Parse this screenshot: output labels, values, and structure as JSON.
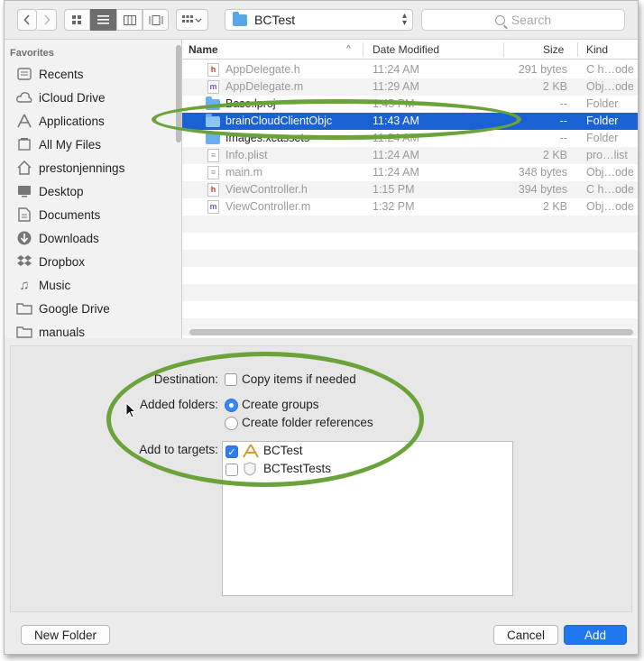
{
  "toolbar": {
    "path_folder": "BCTest",
    "search_placeholder": "Search"
  },
  "sidebar": {
    "section_title": "Favorites",
    "items": [
      {
        "label": "Recents",
        "icon": "clock-icon"
      },
      {
        "label": "iCloud Drive",
        "icon": "cloud-icon"
      },
      {
        "label": "Applications",
        "icon": "applications-icon"
      },
      {
        "label": "All My Files",
        "icon": "all-files-icon"
      },
      {
        "label": "prestonjennings",
        "icon": "home-icon"
      },
      {
        "label": "Desktop",
        "icon": "desktop-icon"
      },
      {
        "label": "Documents",
        "icon": "documents-icon"
      },
      {
        "label": "Downloads",
        "icon": "downloads-icon"
      },
      {
        "label": "Dropbox",
        "icon": "dropbox-icon"
      },
      {
        "label": "Music",
        "icon": "music-icon"
      },
      {
        "label": "Google Drive",
        "icon": "folder-icon"
      },
      {
        "label": "manuals",
        "icon": "folder-icon"
      }
    ]
  },
  "filelist": {
    "columns": {
      "name": "Name",
      "date": "Date Modified",
      "size": "Size",
      "kind": "Kind"
    },
    "rows": [
      {
        "name": "AppDelegate.h",
        "date": "11:24 AM",
        "size": "291 bytes",
        "kind": "C h…ode",
        "icon": "h"
      },
      {
        "name": "AppDelegate.m",
        "date": "11:29 AM",
        "size": "2 KB",
        "kind": "Obj…ode",
        "icon": "m"
      },
      {
        "name": "Base.lproj",
        "date": "1:45 PM",
        "size": "--",
        "kind": "Folder",
        "icon": "folder"
      },
      {
        "name": "brainCloudClientObjc",
        "date": "11:43 AM",
        "size": "--",
        "kind": "Folder",
        "icon": "folder"
      },
      {
        "name": "Images.xcassets",
        "date": "11:24 AM",
        "size": "--",
        "kind": "Folder",
        "icon": "folder"
      },
      {
        "name": "Info.plist",
        "date": "11:24 AM",
        "size": "2 KB",
        "kind": "pro…list",
        "icon": "plist"
      },
      {
        "name": "main.m",
        "date": "11:24 AM",
        "size": "348 bytes",
        "kind": "Obj…ode",
        "icon": "m"
      },
      {
        "name": "ViewController.h",
        "date": "1:15 PM",
        "size": "394 bytes",
        "kind": "C h…ode",
        "icon": "h"
      },
      {
        "name": "ViewController.m",
        "date": "1:32 PM",
        "size": "2 KB",
        "kind": "Obj…ode",
        "icon": "m"
      }
    ]
  },
  "options": {
    "destination_label": "Destination:",
    "copy_items_label": "Copy items if needed",
    "copy_items_checked": false,
    "added_folders_label": "Added folders:",
    "create_groups_label": "Create groups",
    "create_folder_refs_label": "Create folder references",
    "selected_folder_option": "Create groups",
    "add_to_targets_label": "Add to targets:",
    "targets": [
      {
        "name": "BCTest",
        "checked": true
      },
      {
        "name": "BCTestTests",
        "checked": false
      }
    ]
  },
  "buttons": {
    "new_folder": "New Folder",
    "cancel": "Cancel",
    "add": "Add"
  },
  "colors": {
    "selection": "#1a62d4",
    "primary_button": "#1f78f0",
    "annotation_ellipse": "#6aa33a"
  }
}
